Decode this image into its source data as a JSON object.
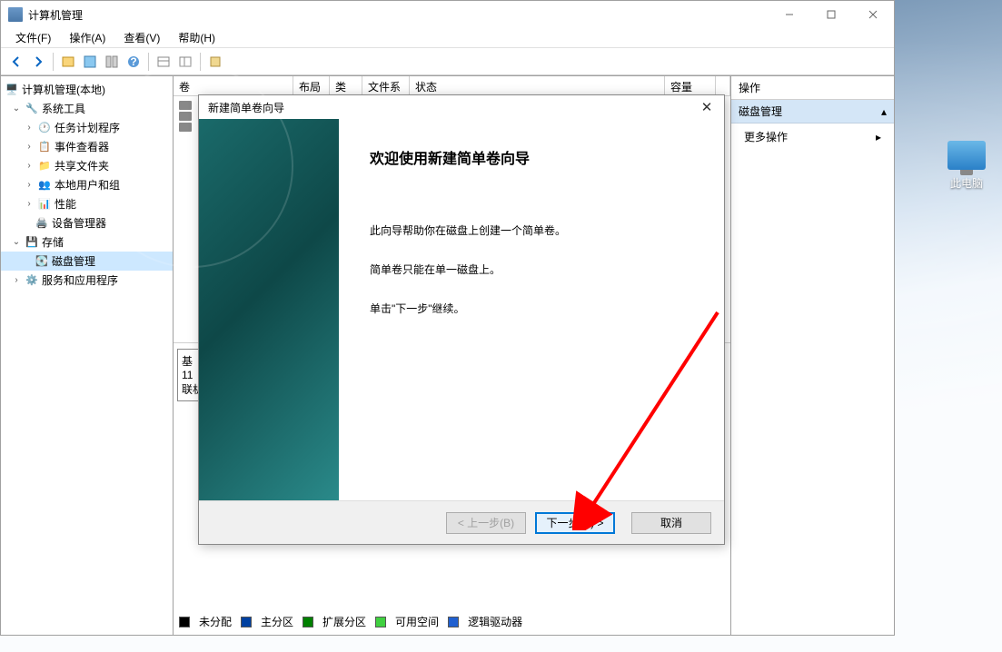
{
  "window": {
    "title": "计算机管理"
  },
  "menu": {
    "file": "文件(F)",
    "action": "操作(A)",
    "view": "查看(V)",
    "help": "帮助(H)"
  },
  "tree": {
    "root": "计算机管理(本地)",
    "sys_tools": "系统工具",
    "task_scheduler": "任务计划程序",
    "event_viewer": "事件查看器",
    "shared_folders": "共享文件夹",
    "local_users": "本地用户和组",
    "performance": "性能",
    "device_manager": "设备管理器",
    "storage": "存储",
    "disk_mgmt": "磁盘管理",
    "services_apps": "服务和应用程序"
  },
  "columns": {
    "vol": "卷",
    "layout": "布局",
    "type": "类型",
    "fs": "文件系统",
    "status": "状态",
    "capacity": "容量"
  },
  "disk": {
    "label": "基",
    "size": "11",
    "online": "联机"
  },
  "legend": {
    "unalloc": "未分配",
    "primary": "主分区",
    "extended": "扩展分区",
    "free": "可用空间",
    "logical": "逻辑驱动器"
  },
  "right": {
    "header": "操作",
    "section": "磁盘管理",
    "more": "更多操作"
  },
  "wizard": {
    "title": "新建简单卷向导",
    "heading": "欢迎使用新建简单卷向导",
    "p1": "此向导帮助你在磁盘上创建一个简单卷。",
    "p2": "简单卷只能在单一磁盘上。",
    "p3": "单击\"下一步\"继续。",
    "back": "< 上一步(B)",
    "next": "下一步(N) >",
    "cancel": "取消"
  },
  "desktop": {
    "this_pc": "此电脑"
  }
}
